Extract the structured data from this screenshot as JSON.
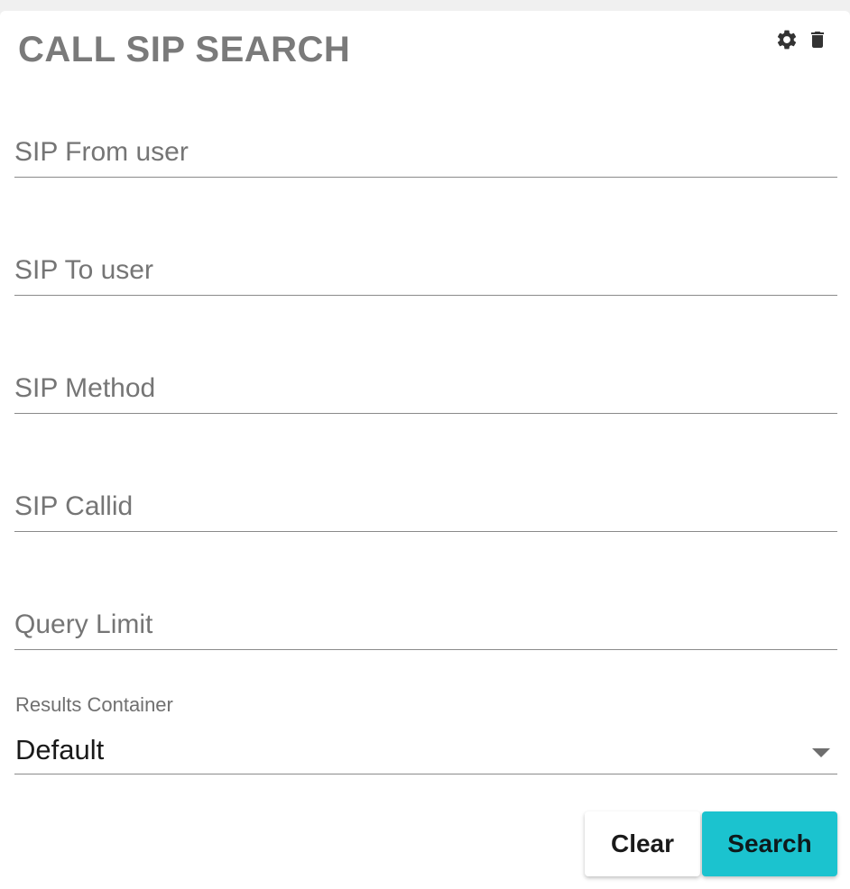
{
  "widget": {
    "title": "CALL SIP SEARCH",
    "icons": [
      "gear-icon",
      "trash-icon"
    ]
  },
  "form": {
    "fields": [
      {
        "placeholder": "SIP From user",
        "value": ""
      },
      {
        "placeholder": "SIP To user",
        "value": ""
      },
      {
        "placeholder": "SIP Method",
        "value": ""
      },
      {
        "placeholder": "SIP Callid",
        "value": ""
      },
      {
        "placeholder": "Query Limit",
        "value": ""
      }
    ],
    "results_container": {
      "label": "Results Container",
      "value": "Default"
    }
  },
  "buttons": {
    "clear": "Clear",
    "search": "Search"
  },
  "colors": {
    "accent": "#1bc3cf"
  }
}
